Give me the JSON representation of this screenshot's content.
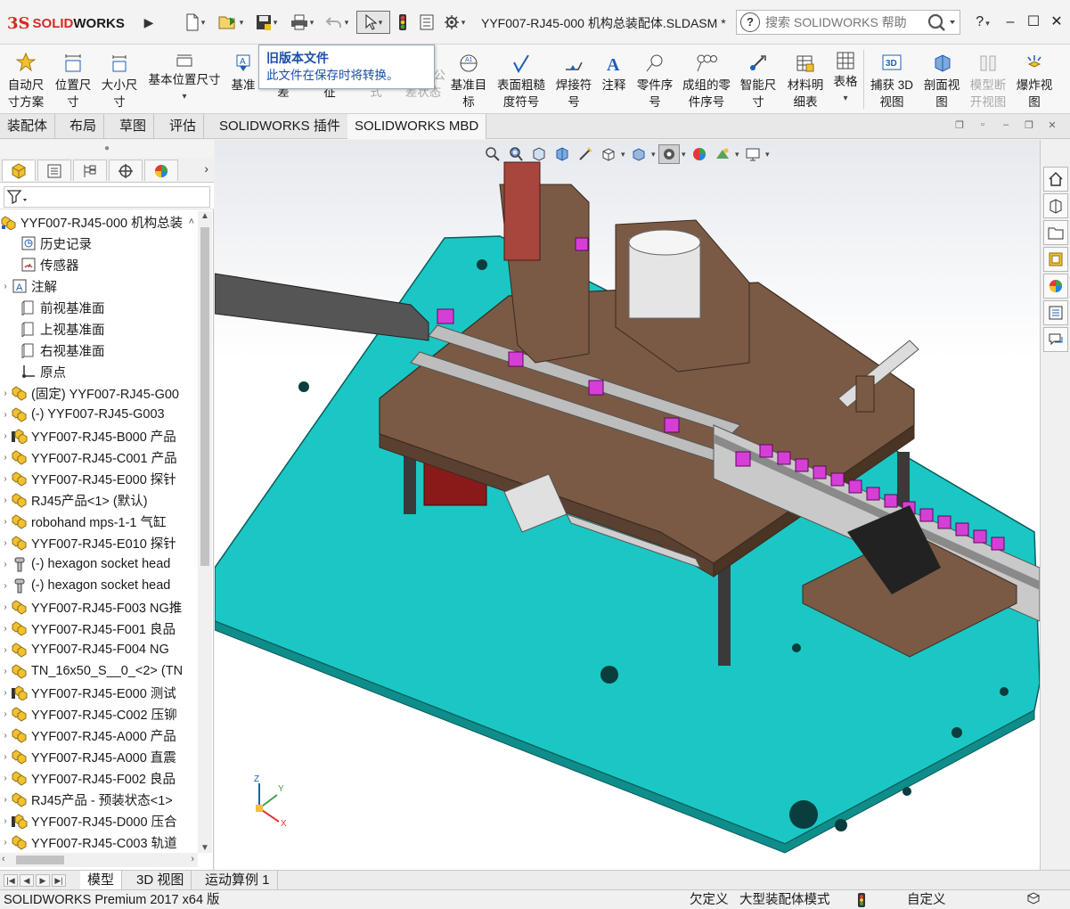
{
  "app": {
    "logo_prefix": "3S",
    "logo_text_a": "SOLID",
    "logo_text_b": "WORKS",
    "document_title": "YYF007-RJ45-000   机构总装配体.SLDASM *",
    "help_search_placeholder": "搜索 SOLIDWORKS 帮助",
    "help_label": "?",
    "colors": {
      "brand_red": "#d52b1e",
      "tooltip_blue": "#1b4fa8",
      "plate": "#19c6c6",
      "frame": "#7a5a45",
      "product": "#d63fd6"
    }
  },
  "quick_access": [
    "new-doc-icon",
    "open-icon",
    "save-icon",
    "print-icon",
    "undo-icon",
    "select-icon",
    "rebuild-icon",
    "file-properties-icon",
    "options-icon"
  ],
  "tooltip": {
    "title": "旧版本文件",
    "body": "此文件在保存时将转换。"
  },
  "command_manager": [
    {
      "id": "auto-dim",
      "line1": "自动尺",
      "line2": "寸方案",
      "icon": "auto-dimension-icon",
      "enabled": true
    },
    {
      "id": "location-dim",
      "line1": "位置尺",
      "line2": "寸",
      "icon": "location-dimension-icon",
      "enabled": true
    },
    {
      "id": "size-dim",
      "line1": "大小尺",
      "line2": "寸",
      "icon": "size-dimension-icon",
      "enabled": true
    },
    {
      "id": "basic-location-dim",
      "line1": "基本位置尺寸",
      "line2": "",
      "icon": "basic-location-dimension-icon",
      "enabled": true
    },
    {
      "id": "datum",
      "line1": "基准",
      "line2": "",
      "icon": "datum-icon",
      "enabled": true
    },
    {
      "id": "datum-hidden",
      "line1": "",
      "line2": "差",
      "icon": "",
      "enabled": true
    },
    {
      "id": "feature-hidden",
      "line1": "",
      "line2": "征",
      "icon": "",
      "enabled": true
    },
    {
      "id": "style-hidden",
      "line1": "",
      "line2": "式",
      "icon": "",
      "enabled": false
    },
    {
      "id": "tolerance-status",
      "line1": "公",
      "line2": "差状态",
      "icon": "",
      "enabled": false
    },
    {
      "id": "datum-target",
      "line1": "基准目",
      "line2": "标",
      "icon": "datum-target-icon",
      "enabled": true
    },
    {
      "id": "surface-finish",
      "line1": "表面粗糙",
      "line2": "度符号",
      "icon": "surface-finish-icon",
      "enabled": true
    },
    {
      "id": "weld-symbol",
      "line1": "焊接符",
      "line2": "号",
      "icon": "weld-symbol-icon",
      "enabled": true
    },
    {
      "id": "note",
      "line1": "注释",
      "line2": "",
      "icon": "note-icon",
      "enabled": true
    },
    {
      "id": "balloon",
      "line1": "零件序",
      "line2": "号",
      "icon": "balloon-icon",
      "enabled": true
    },
    {
      "id": "stacked-balloon",
      "line1": "成组的零",
      "line2": "件序号",
      "icon": "stacked-balloon-icon",
      "enabled": true
    },
    {
      "id": "smart-dim",
      "line1": "智能尺",
      "line2": "寸",
      "icon": "smart-dimension-icon",
      "enabled": true
    },
    {
      "id": "bom",
      "line1": "材料明",
      "line2": "细表",
      "icon": "bom-icon",
      "enabled": true
    },
    {
      "id": "table",
      "line1": "表格",
      "line2": "",
      "icon": "table-icon",
      "enabled": true
    },
    {
      "id": "capture-3d",
      "line1": "捕获 3D",
      "line2": "视图",
      "icon": "capture-3d-view-icon",
      "enabled": true
    },
    {
      "id": "section-view",
      "line1": "剖面视",
      "line2": "图",
      "icon": "section-view-icon",
      "enabled": true
    },
    {
      "id": "model-break",
      "line1": "模型断",
      "line2": "开视图",
      "icon": "model-break-view-icon",
      "enabled": false
    },
    {
      "id": "explode",
      "line1": "爆炸视",
      "line2": "图",
      "icon": "explode-view-icon",
      "enabled": true
    }
  ],
  "tabs": [
    "装配体",
    "布局",
    "草图",
    "评估",
    "SOLIDWORKS 插件",
    "SOLIDWORKS MBD"
  ],
  "active_tab": "SOLIDWORKS MBD",
  "feature_tree": {
    "root": "YYF007-RJ45-000   机构总装",
    "items": [
      {
        "label": "历史记录",
        "icon": "history-icon",
        "expandable": false
      },
      {
        "label": "传感器",
        "icon": "sensor-icon",
        "expandable": false
      },
      {
        "label": "注解",
        "icon": "annotations-icon",
        "expandable": true
      },
      {
        "label": "前视基准面",
        "icon": "plane-icon",
        "expandable": false
      },
      {
        "label": "上视基准面",
        "icon": "plane-icon",
        "expandable": false
      },
      {
        "label": "右视基准面",
        "icon": "plane-icon",
        "expandable": false
      },
      {
        "label": "原点",
        "icon": "origin-icon",
        "expandable": false
      },
      {
        "label": "(固定) YYF007-RJ45-G00",
        "icon": "subassembly-icon",
        "expandable": true
      },
      {
        "label": "(-) YYF007-RJ45-G003   ",
        "icon": "subassembly-icon",
        "expandable": true
      },
      {
        "label": "YYF007-RJ45-B000   产品",
        "icon": "subassembly-warning-icon",
        "expandable": true
      },
      {
        "label": "YYF007-RJ45-C001   产品",
        "icon": "subassembly-icon",
        "expandable": true
      },
      {
        "label": "YYF007-RJ45-E000   探针",
        "icon": "subassembly-icon",
        "expandable": true
      },
      {
        "label": "RJ45产品<1> (默认)",
        "icon": "subassembly-icon",
        "expandable": true
      },
      {
        "label": "robohand mps-1-1 气缸",
        "icon": "subassembly-icon",
        "expandable": true
      },
      {
        "label": "YYF007-RJ45-E010   探针",
        "icon": "subassembly-icon",
        "expandable": true
      },
      {
        "label": "(-) hexagon socket head",
        "icon": "screw-icon",
        "expandable": true
      },
      {
        "label": "(-) hexagon socket head",
        "icon": "screw-icon",
        "expandable": true
      },
      {
        "label": "YYF007-RJ45-F003 NG推",
        "icon": "subassembly-icon",
        "expandable": true
      },
      {
        "label": "YYF007-RJ45-F001   良品",
        "icon": "subassembly-icon",
        "expandable": true
      },
      {
        "label": "YYF007-RJ45-F004   NG",
        "icon": "subassembly-icon",
        "expandable": true
      },
      {
        "label": "TN_16x50_S__0_<2> (TN",
        "icon": "subassembly-icon",
        "expandable": true
      },
      {
        "label": "YYF007-RJ45-E000   测试",
        "icon": "subassembly-warning-icon",
        "expandable": true
      },
      {
        "label": "YYF007-RJ45-C002   压铆",
        "icon": "subassembly-icon",
        "expandable": true
      },
      {
        "label": "YYF007-RJ45-A000   产品",
        "icon": "subassembly-icon",
        "expandable": true
      },
      {
        "label": "YYF007-RJ45-A000   直震",
        "icon": "subassembly-icon",
        "expandable": true
      },
      {
        "label": "YYF007-RJ45-F002   良品",
        "icon": "subassembly-icon",
        "expandable": true
      },
      {
        "label": "RJ45产品 - 预装状态<1>",
        "icon": "subassembly-icon",
        "expandable": true
      },
      {
        "label": "YYF007-RJ45-D000   压合",
        "icon": "subassembly-warning-icon",
        "expandable": true
      },
      {
        "label": "YYF007-RJ45-C003   轨道",
        "icon": "subassembly-icon",
        "expandable": true
      }
    ]
  },
  "triad": {
    "x": "X",
    "y": "Y",
    "z": "Z"
  },
  "bottom_tabs": [
    "模型",
    "3D 视图",
    "运动算例 1"
  ],
  "active_bottom_tab": "模型",
  "status_bar": {
    "product": "SOLIDWORKS Premium 2017 x64 版",
    "constraint": "欠定义",
    "mode": "大型装配体模式",
    "units": "自定义"
  }
}
